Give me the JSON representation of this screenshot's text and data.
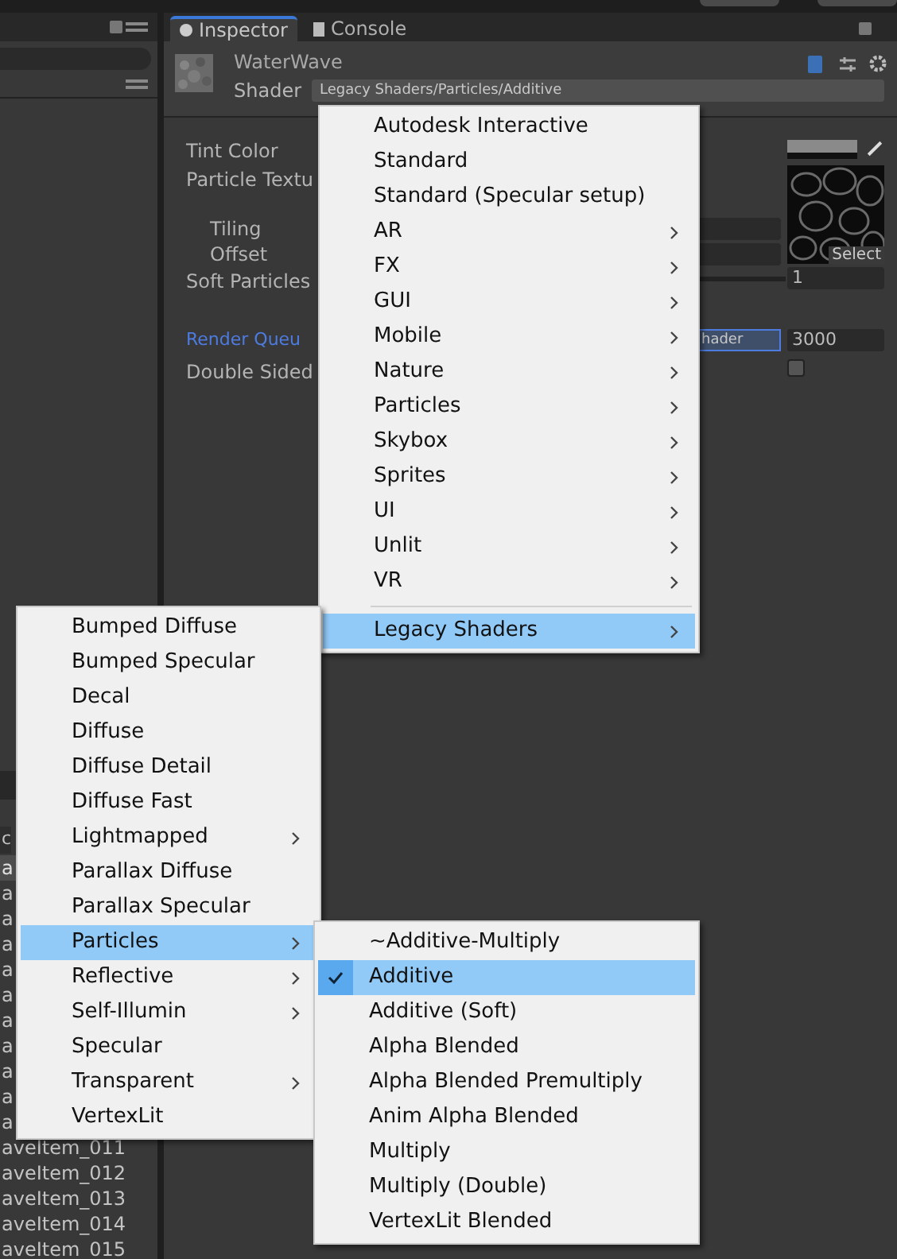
{
  "hierarchy": {
    "header_text": "c",
    "rows": [
      {
        "label": "a",
        "selected": true
      },
      {
        "label": "a",
        "selected": false
      },
      {
        "label": "a",
        "selected": false
      },
      {
        "label": "a",
        "selected": false
      },
      {
        "label": "a",
        "selected": false
      },
      {
        "label": "a",
        "selected": false
      },
      {
        "label": "a",
        "selected": false
      },
      {
        "label": "a",
        "selected": false
      },
      {
        "label": "a",
        "selected": false
      },
      {
        "label": "a",
        "selected": false
      },
      {
        "label": "a",
        "selected": false
      },
      {
        "label": "aveItem_011",
        "selected": false
      },
      {
        "label": "aveItem_012",
        "selected": false
      },
      {
        "label": "aveItem_013",
        "selected": false
      },
      {
        "label": "aveItem_014",
        "selected": false
      },
      {
        "label": "aveItem_015",
        "selected": false
      }
    ]
  },
  "tabs": [
    {
      "label": "Inspector",
      "selected": true
    },
    {
      "label": "Console",
      "selected": false
    }
  ],
  "material": {
    "name": "WaterWave",
    "shader_label": "Shader",
    "shader": "Legacy Shaders/Particles/Additive"
  },
  "properties": [
    {
      "label": "Tint Color",
      "kind": "color"
    },
    {
      "label": "Particle Textu",
      "kind": "texture",
      "button": "Select"
    },
    {
      "label": "Tiling",
      "kind": "sub"
    },
    {
      "label": "Offset",
      "kind": "sub"
    },
    {
      "label": "Soft Particles",
      "kind": "slider",
      "value": "1"
    },
    {
      "label": "Render Queu",
      "kind": "queue",
      "mode": "hader",
      "value": "3000"
    },
    {
      "label": "Double Sided",
      "kind": "check",
      "checked": false
    }
  ],
  "menus": [
    {
      "items": [
        {
          "label": "Autodesk Interactive",
          "submenu": false,
          "selected": false
        },
        {
          "label": "Standard",
          "submenu": false,
          "selected": false
        },
        {
          "label": "Standard (Specular setup)",
          "submenu": false,
          "selected": false
        },
        {
          "label": "AR",
          "submenu": true,
          "selected": false
        },
        {
          "label": "FX",
          "submenu": true,
          "selected": false
        },
        {
          "label": "GUI",
          "submenu": true,
          "selected": false
        },
        {
          "label": "Mobile",
          "submenu": true,
          "selected": false
        },
        {
          "label": "Nature",
          "submenu": true,
          "selected": false
        },
        {
          "label": "Particles",
          "submenu": true,
          "selected": false
        },
        {
          "label": "Skybox",
          "submenu": true,
          "selected": false
        },
        {
          "label": "Sprites",
          "submenu": true,
          "selected": false
        },
        {
          "label": "UI",
          "submenu": true,
          "selected": false
        },
        {
          "label": "Unlit",
          "submenu": true,
          "selected": false
        },
        {
          "label": "VR",
          "submenu": true,
          "selected": false
        },
        {
          "kind": "separator"
        },
        {
          "label": "Legacy Shaders",
          "submenu": true,
          "selected": true
        }
      ]
    },
    {
      "items": [
        {
          "label": "Bumped Diffuse",
          "submenu": false,
          "selected": false
        },
        {
          "label": "Bumped Specular",
          "submenu": false,
          "selected": false
        },
        {
          "label": "Decal",
          "submenu": false,
          "selected": false
        },
        {
          "label": "Diffuse",
          "submenu": false,
          "selected": false
        },
        {
          "label": "Diffuse Detail",
          "submenu": false,
          "selected": false
        },
        {
          "label": "Diffuse Fast",
          "submenu": false,
          "selected": false
        },
        {
          "label": "Lightmapped",
          "submenu": true,
          "selected": false
        },
        {
          "label": "Parallax Diffuse",
          "submenu": false,
          "selected": false
        },
        {
          "label": "Parallax Specular",
          "submenu": false,
          "selected": false
        },
        {
          "label": "Particles",
          "submenu": true,
          "selected": true
        },
        {
          "label": "Reflective",
          "submenu": true,
          "selected": false
        },
        {
          "label": "Self-Illumin",
          "submenu": true,
          "selected": false
        },
        {
          "label": "Specular",
          "submenu": false,
          "selected": false
        },
        {
          "label": "Transparent",
          "submenu": true,
          "selected": false
        },
        {
          "label": "VertexLit",
          "submenu": false,
          "selected": false
        }
      ]
    },
    {
      "items": [
        {
          "label": "~Additive-Multiply",
          "submenu": false,
          "selected": false,
          "checked": false
        },
        {
          "label": "Additive",
          "submenu": false,
          "selected": true,
          "checked": true
        },
        {
          "label": "Additive (Soft)",
          "submenu": false,
          "selected": false,
          "checked": false
        },
        {
          "label": "Alpha Blended",
          "submenu": false,
          "selected": false,
          "checked": false
        },
        {
          "label": "Alpha Blended Premultiply",
          "submenu": false,
          "selected": false,
          "checked": false
        },
        {
          "label": "Anim Alpha Blended",
          "submenu": false,
          "selected": false,
          "checked": false
        },
        {
          "label": "Multiply",
          "submenu": false,
          "selected": false,
          "checked": false
        },
        {
          "label": "Multiply (Double)",
          "submenu": false,
          "selected": false,
          "checked": false
        },
        {
          "label": "VertexLit Blended",
          "submenu": false,
          "selected": false,
          "checked": false
        }
      ]
    }
  ]
}
